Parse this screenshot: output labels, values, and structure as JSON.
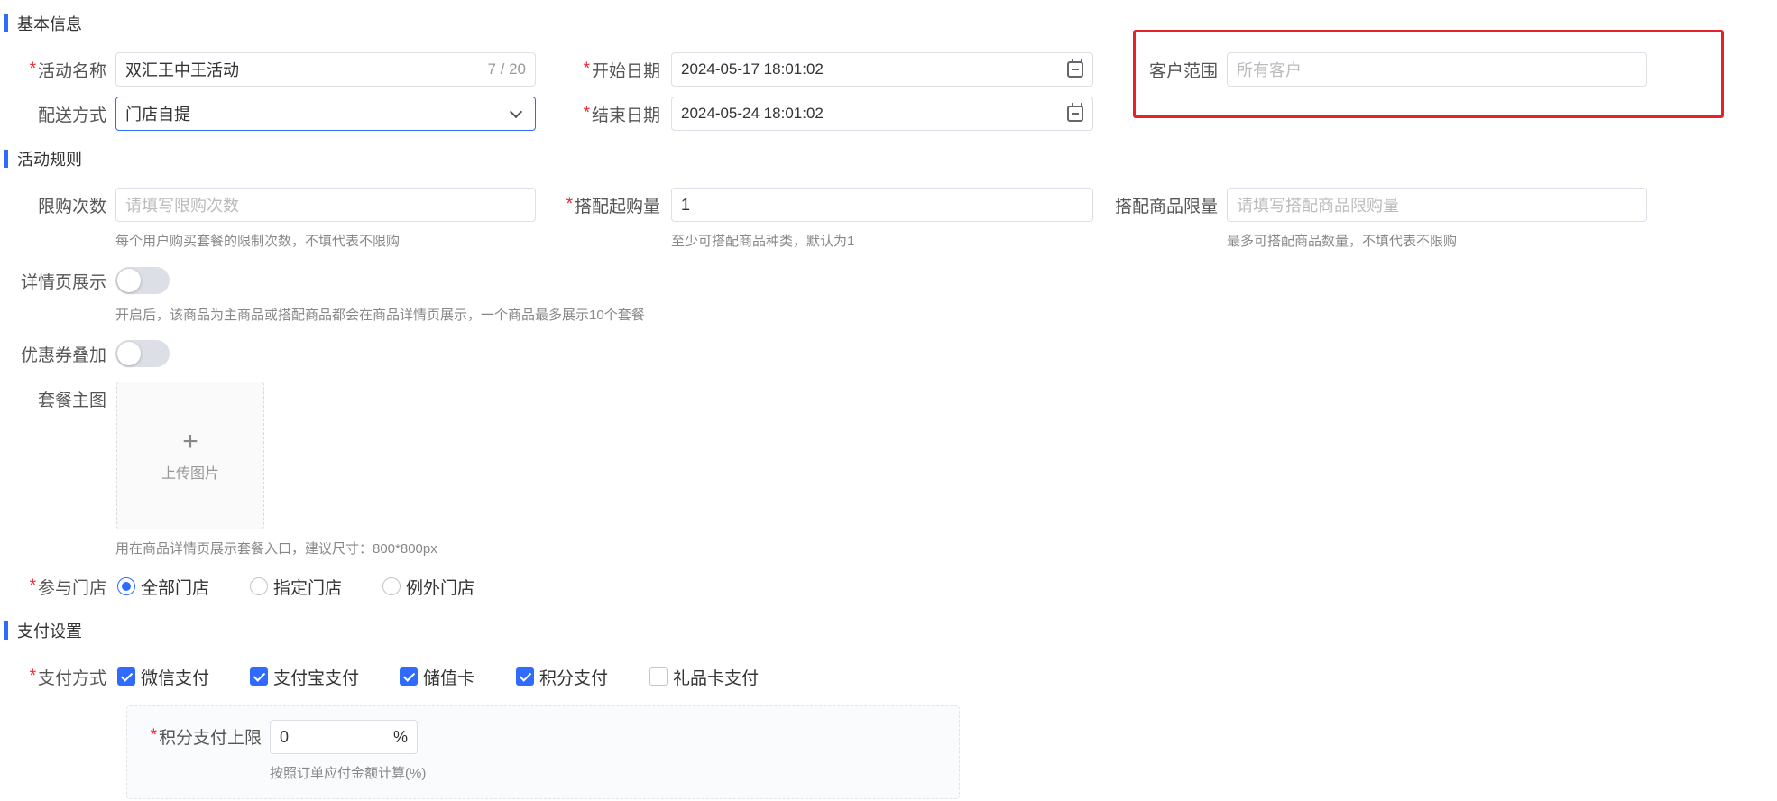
{
  "sections": {
    "basic": "基本信息",
    "rules": "活动规则",
    "payment": "支付设置"
  },
  "basic": {
    "activity_name_label": "活动名称",
    "activity_name_value": "双汇王中王活动",
    "activity_name_count": "7 / 20",
    "start_date_label": "开始日期",
    "start_date_value": "2024-05-17 18:01:02",
    "customer_scope_label": "客户范围",
    "customer_scope_placeholder": "所有客户",
    "delivery_label": "配送方式",
    "delivery_value": "门店自提",
    "end_date_label": "结束日期",
    "end_date_value": "2024-05-24 18:01:02"
  },
  "rules": {
    "limit_times_label": "限购次数",
    "limit_times_placeholder": "请填写限购次数",
    "limit_times_hint": "每个用户购买套餐的限制次数，不填代表不限购",
    "min_bundle_label": "搭配起购量",
    "min_bundle_value": "1",
    "min_bundle_hint": "至少可搭配商品种类，默认为1",
    "bundle_limit_label": "搭配商品限量",
    "bundle_limit_placeholder": "请填写搭配商品限购量",
    "bundle_limit_hint": "最多可搭配商品数量，不填代表不限购",
    "detail_show_label": "详情页展示",
    "detail_show_on": false,
    "detail_show_hint": "开启后，该商品为主商品或搭配商品都会在商品详情页展示，一个商品最多展示10个套餐",
    "coupon_stack_label": "优惠券叠加",
    "coupon_stack_on": false,
    "main_image_label": "套餐主图",
    "upload_plus": "+",
    "upload_text": "上传图片",
    "main_image_hint": "用在商品详情页展示套餐入口，建议尺寸：800*800px",
    "stores_label": "参与门店",
    "stores_options": [
      "全部门店",
      "指定门店",
      "例外门店"
    ],
    "stores_selected": "全部门店"
  },
  "payment": {
    "methods_label": "支付方式",
    "methods": [
      {
        "label": "微信支付",
        "checked": true
      },
      {
        "label": "支付宝支付",
        "checked": true
      },
      {
        "label": "储值卡",
        "checked": true
      },
      {
        "label": "积分支付",
        "checked": true
      },
      {
        "label": "礼品卡支付",
        "checked": false
      }
    ],
    "points_limit_label": "积分支付上限",
    "points_limit_value": "0",
    "points_limit_unit": "%",
    "points_limit_hint": "按照订单应付金额计算(%)"
  },
  "required_mark": "*",
  "colors": {
    "accent": "#2f6bff",
    "required": "#f5222d",
    "highlight": "#e8202a"
  }
}
